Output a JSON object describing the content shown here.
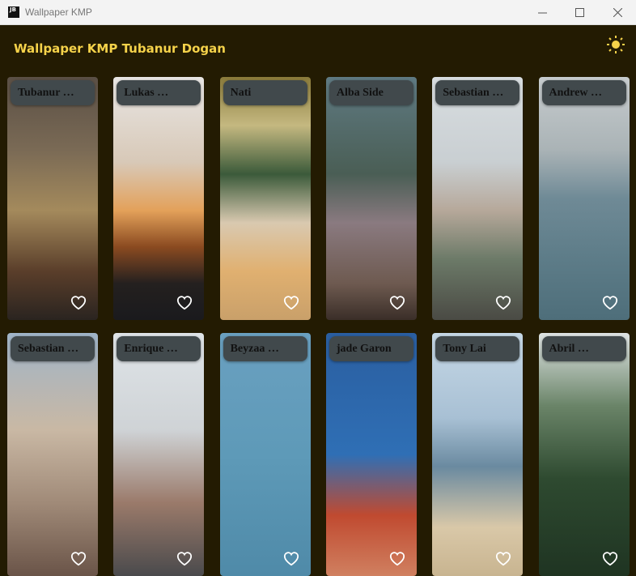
{
  "window": {
    "title": "Wallpaper KMP",
    "app_icon": "JB"
  },
  "header": {
    "title": "Wallpaper KMP Tubanur Dogan",
    "theme_icon": "sun-icon",
    "accent": "#f5d24a"
  },
  "wallpapers": [
    {
      "author": "Tubanur …",
      "bg": "linear-gradient(180deg,#5a4f45 0%,#7a6a55 30%,#a48a5c 55%,#5a3e2a 80%,#2a2420 100%)"
    },
    {
      "author": "Lukas …",
      "bg": "linear-gradient(180deg,#e8e6e4 0%,#d8c9b8 35%,#e3a15a 55%,#8a4a20 70%,#24201f 85%,#1a1a1d 100%)"
    },
    {
      "author": "Nati",
      "bg": "linear-gradient(180deg,#8a7a3a 0%,#c4b880 20%,#3b5a3a 40%,#d9c9b0 60%,#e0b070 80%,#c9a06a 100%)"
    },
    {
      "author": "Alba  Side",
      "bg": "linear-gradient(180deg,#5f7a82 0%,#4a5e55 40%,#8a7a80 60%,#6e5a50 85%,#3a2e28 100%)"
    },
    {
      "author": "Sebastian …",
      "bg": "linear-gradient(180deg,#d8dde0 0%,#c9cfd2 35%,#b6a89a 55%,#6c7a68 75%,#4a4a44 100%)"
    },
    {
      "author": "Andrew …",
      "bg": "linear-gradient(180deg,#c7ccce 0%,#aab3b6 30%,#6f8a96 50%,#5d7c88 75%,#4e6e7a 100%)"
    },
    {
      "author": "Sebastian …",
      "bg": "linear-gradient(180deg,#9fb4c8 0%,#c9b8a4 40%,#a08a78 70%,#6a5448 100%)"
    },
    {
      "author": "Enrique …",
      "bg": "linear-gradient(180deg,#dfe4e8 0%,#cfd3d6 40%,#9a7a6a 70%,#4a4a4c 100%)"
    },
    {
      "author": "Beyzaa …",
      "bg": "linear-gradient(180deg,#6aa0c0 0%,#5e9ab8 50%,#4f8aa8 100%)"
    },
    {
      "author": "jade Garon",
      "bg": "linear-gradient(180deg,#2a5ea0 0%,#2f6fb5 50%,#c04a30 75%,#d08060 100%)"
    },
    {
      "author": "Tony Lai",
      "bg": "linear-gradient(180deg,#c6d8e6 0%,#a8c0d4 35%,#6a8aa0 55%,#d9c8a8 80%,#c8b490 100%)"
    },
    {
      "author": "Abril …",
      "bg": "linear-gradient(180deg,#dfe4e4 0%,#6a8468 30%,#2e4a30 60%,#1f3422 100%)"
    }
  ],
  "favorite_icon": "heart-outline-icon"
}
